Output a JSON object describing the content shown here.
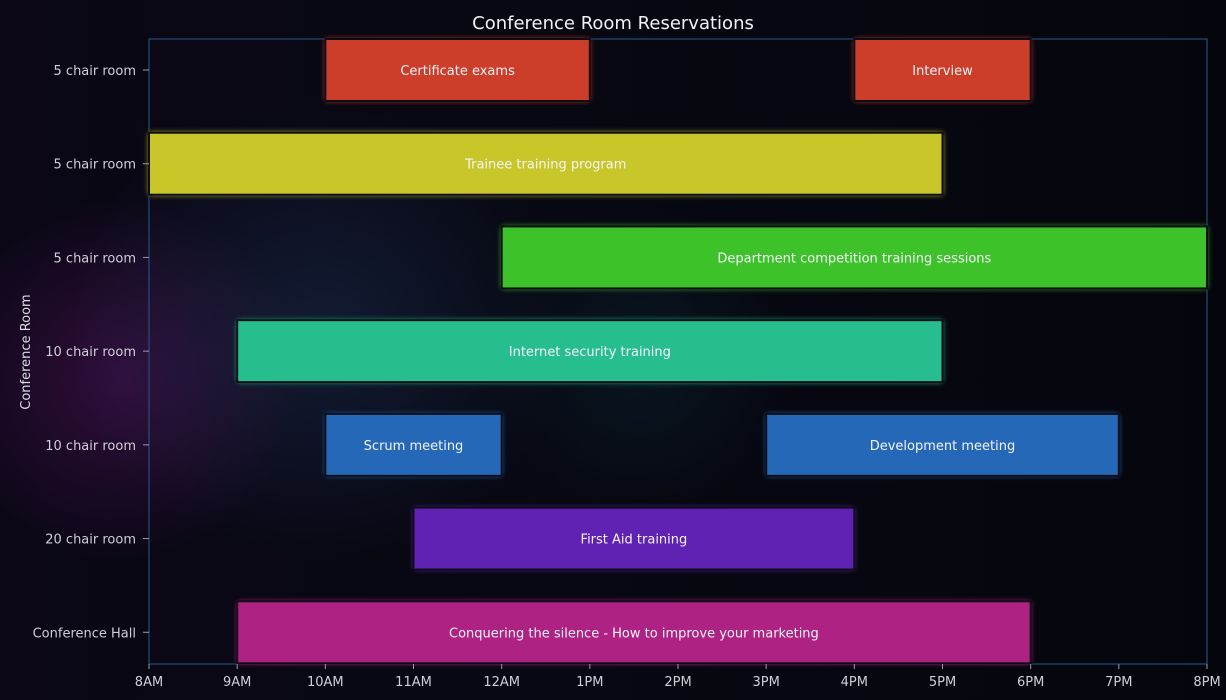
{
  "chart_data": {
    "type": "gantt",
    "title": "Conference Room Reservations",
    "xlabel": "",
    "ylabel": "Conference Room",
    "x_ticks": [
      "8AM",
      "9AM",
      "10AM",
      "11AM",
      "12AM",
      "1PM",
      "2PM",
      "3PM",
      "4PM",
      "5PM",
      "6PM",
      "7PM",
      "8PM"
    ],
    "xlim_hours": [
      8,
      20
    ],
    "rows": [
      "5 chair room",
      "5 chair room",
      "5 chair room",
      "10 chair room",
      "10 chair room",
      "20 chair room",
      "Conference Hall"
    ],
    "tasks": [
      {
        "row": 0,
        "label": "Certificate exams",
        "start": 10,
        "end": 13,
        "color": "#cc3d2c"
      },
      {
        "row": 0,
        "label": "Interview",
        "start": 16,
        "end": 18,
        "color": "#cc3d2c"
      },
      {
        "row": 1,
        "label": "Trainee training program",
        "start": 8,
        "end": 17,
        "color": "#c9c62b"
      },
      {
        "row": 2,
        "label": "Department competition training sessions",
        "start": 12,
        "end": 20,
        "color": "#3dc22a"
      },
      {
        "row": 3,
        "label": "Internet security training",
        "start": 9,
        "end": 17,
        "color": "#27be8e"
      },
      {
        "row": 4,
        "label": "Scrum meeting",
        "start": 10,
        "end": 12,
        "color": "#2868b8"
      },
      {
        "row": 4,
        "label": "Development meeting",
        "start": 15,
        "end": 19,
        "color": "#2868b8"
      },
      {
        "row": 5,
        "label": "First Aid training",
        "start": 11,
        "end": 16,
        "color": "#5e24b3"
      },
      {
        "row": 6,
        "label": "Conquering the silence - How to improve your marketing",
        "start": 9,
        "end": 18,
        "color": "#ad2283"
      }
    ],
    "grid": false,
    "legend": "none"
  }
}
